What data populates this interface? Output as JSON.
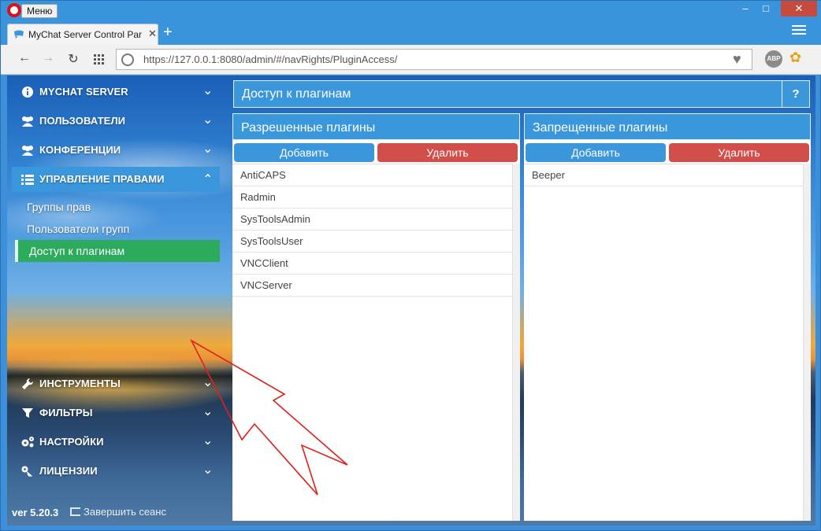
{
  "browser": {
    "menu_label": "Меню",
    "tab_title": "MyChat Server Control Par",
    "url": "https://127.0.0.1:8080/admin/#/navRights/PluginAccess/",
    "abp_label": "ABP"
  },
  "sidebar": {
    "items": [
      {
        "label": "MYCHAT SERVER",
        "icon": "info-icon"
      },
      {
        "label": "ПОЛЬЗОВАТЕЛИ",
        "icon": "users-icon"
      },
      {
        "label": "КОНФЕРЕНЦИИ",
        "icon": "users-icon"
      },
      {
        "label": "УПРАВЛЕНИЕ ПРАВАМИ",
        "icon": "list-icon"
      },
      {
        "label": "ИНСТРУМЕНТЫ",
        "icon": "wrench-icon"
      },
      {
        "label": "ФИЛЬТРЫ",
        "icon": "filter-icon"
      },
      {
        "label": "НАСТРОЙКИ",
        "icon": "gears-icon"
      },
      {
        "label": "ЛИЦЕНЗИИ",
        "icon": "key-icon"
      }
    ],
    "subitems": [
      {
        "label": "Группы прав"
      },
      {
        "label": "Пользователи групп"
      },
      {
        "label": "Доступ к плагинам"
      }
    ],
    "version": "ver 5.20.3",
    "logout_label": "Завершить сеанс"
  },
  "main": {
    "title": "Доступ к плагинам",
    "help_label": "?",
    "allowed": {
      "title": "Разрешенные плагины",
      "add_label": "Добавить",
      "delete_label": "Удалить",
      "items": [
        "AntiCAPS",
        "Radmin",
        "SysToolsAdmin",
        "SysToolsUser",
        "VNCClient",
        "VNCServer"
      ]
    },
    "denied": {
      "title": "Запрещенные плагины",
      "add_label": "Добавить",
      "delete_label": "Удалить",
      "items": [
        "Beeper"
      ]
    }
  },
  "colors": {
    "accent_blue": "#3b97dc",
    "delete_red": "#d24e4b",
    "active_green": "#2bab5b"
  }
}
